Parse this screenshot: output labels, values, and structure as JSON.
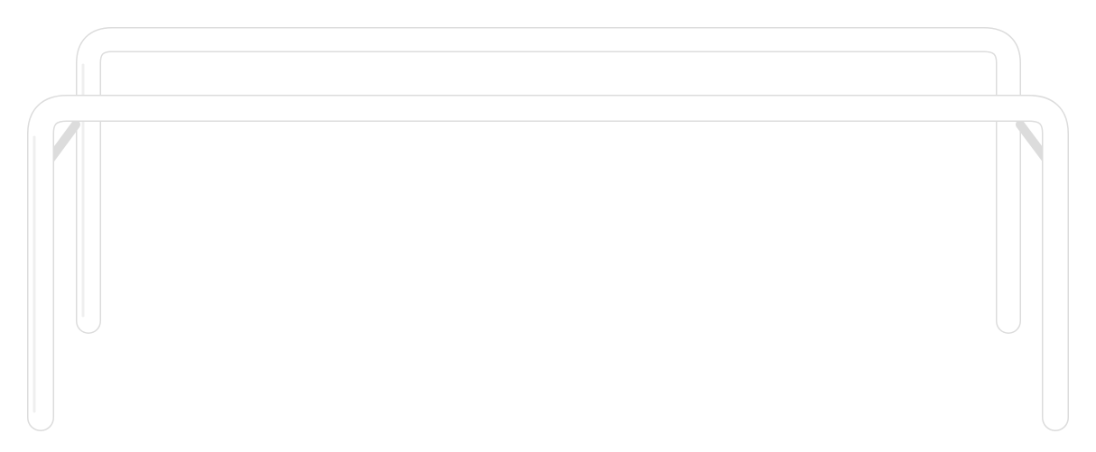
{
  "image": {
    "subject": "table-frame",
    "colors": {
      "background": "#ffffff",
      "tube_fill": "#ffffff",
      "tube_outline": "#dcdcdc",
      "tube_shadow": "#efefef"
    }
  }
}
